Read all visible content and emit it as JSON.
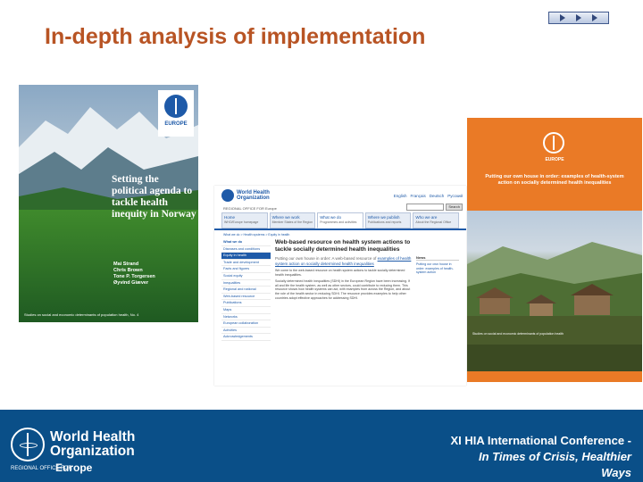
{
  "slide": {
    "title": "In-depth analysis of implementation"
  },
  "cover_norway": {
    "badge_text": "EUROPE",
    "title": "Setting the political agenda to tackle health inequity in Norway",
    "authors": [
      "Mai Strand",
      "Chris Brown",
      "Tone P. Torgersen",
      "Øyvind Giæver"
    ],
    "series": "Studies on social and economic determinants of population health, No. 4"
  },
  "website": {
    "logo_text": "World Health Organization",
    "regional_office": "REGIONAL OFFICE FOR Europe",
    "languages": [
      "English",
      "Français",
      "Deutsch",
      "Русский"
    ],
    "search_button": "Search",
    "tabs": [
      {
        "label": "Home",
        "sub": "WHO/Europe homepage"
      },
      {
        "label": "Where we work",
        "sub": "Member States of the Region"
      },
      {
        "label": "What we do",
        "sub": "Programmes and activities"
      },
      {
        "label": "Where we publish",
        "sub": "Publications and reports"
      },
      {
        "label": "Who we are",
        "sub": "About the Regional Office"
      }
    ],
    "breadcrumb": "What we do > Health systems > Equity in health",
    "sidebar": [
      "What we do",
      "Diseases and conditions",
      "Equity in health",
      "Trade and development",
      "Facts and figures",
      "Social equity",
      "Inequalities",
      "Regional and national",
      "Web-based resource",
      "Publications",
      "Maps",
      "Networks",
      "European collaboration",
      "Activities",
      "Acknowledgements"
    ],
    "main_title": "Web-based resource on health system actions to tackle socially determined health inequalities",
    "main_intro_prefix": "Putting our own house in order: A web-based resource of ",
    "main_intro_link": "examples of health system action on socially determined health inequalities",
    "main_p1": "We come to the web-based resource on health system actions to tackle socially determined health inequalities.",
    "main_p2": "Socially determined health inequalities (SDHI) in the European Region have been increasing. If all and life the health system, as well as other sectors, could contribute to reducing them. This resource shows how health systems can act, with examples from across the Region, and about the role of the health sector in reducing SDHI. The resource provides examples to help other countries adopt effective approaches for addressing SDHI.",
    "right_head": "News",
    "right_text": "Putting our own house in order: examples of health-system action"
  },
  "cover_orange": {
    "europe": "EUROPE",
    "title": "Putting our own house in order: examples of health-system action on socially determined health inequalities",
    "caption": "Studies on social and economic determinants of population health"
  },
  "footer": {
    "logo_line1": "World Health",
    "logo_line2": "Organization",
    "regional": "REGIONAL OFFICE FOR",
    "europe": "Europe",
    "conf_line1": "XI HIA International Conference -",
    "conf_line2": "In Times of Crisis, Healthier",
    "conf_line3": "Ways"
  },
  "colors": {
    "title": "#b85424",
    "footer_bg": "#0a4f88",
    "who_blue": "#1e5aa8",
    "orange_cover": "#ea7a26"
  }
}
